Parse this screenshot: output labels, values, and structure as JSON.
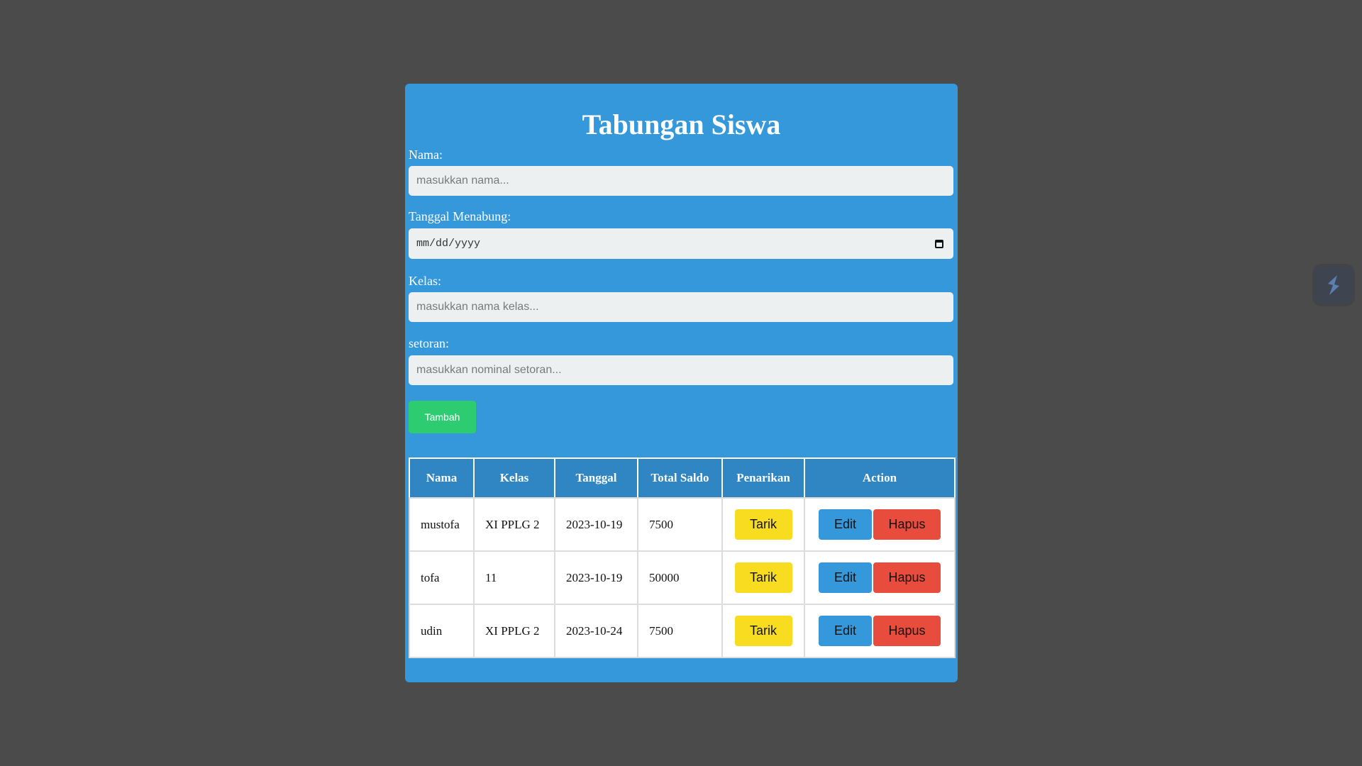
{
  "app": {
    "title": "Tabungan Siswa"
  },
  "form": {
    "nama": {
      "label": "Nama:",
      "placeholder": "masukkan nama..."
    },
    "tanggal": {
      "label": "Tanggal Menabung:",
      "placeholder": "mm/dd/yyyy"
    },
    "kelas": {
      "label": "Kelas:",
      "placeholder": "masukkan nama kelas..."
    },
    "setoran": {
      "label": "setoran:",
      "placeholder": "masukkan nominal setoran..."
    },
    "submit_label": "Tambah"
  },
  "table": {
    "headers": [
      "Nama",
      "Kelas",
      "Tanggal",
      "Total Saldo",
      "Penarikan",
      "Action"
    ],
    "rows": [
      {
        "nama": "mustofa",
        "kelas": "XI PPLG 2",
        "tanggal": "2023-10-19",
        "saldo": "7500"
      },
      {
        "nama": "tofa",
        "kelas": "11",
        "tanggal": "2023-10-19",
        "saldo": "50000"
      },
      {
        "nama": "udin",
        "kelas": "XI PPLG 2",
        "tanggal": "2023-10-24",
        "saldo": "7500"
      }
    ],
    "tarik_label": "Tarik",
    "edit_label": "Edit",
    "hapus_label": "Hapus"
  },
  "colors": {
    "background": "#4b4b4b",
    "card": "#3498db",
    "header": "#2f86c2",
    "add": "#2ecc71",
    "tarik": "#f7dc1f",
    "edit": "#3498db",
    "hapus": "#e74c3c"
  },
  "icons": {
    "calendar": "calendar-icon",
    "extension": "extension-widget-icon"
  }
}
